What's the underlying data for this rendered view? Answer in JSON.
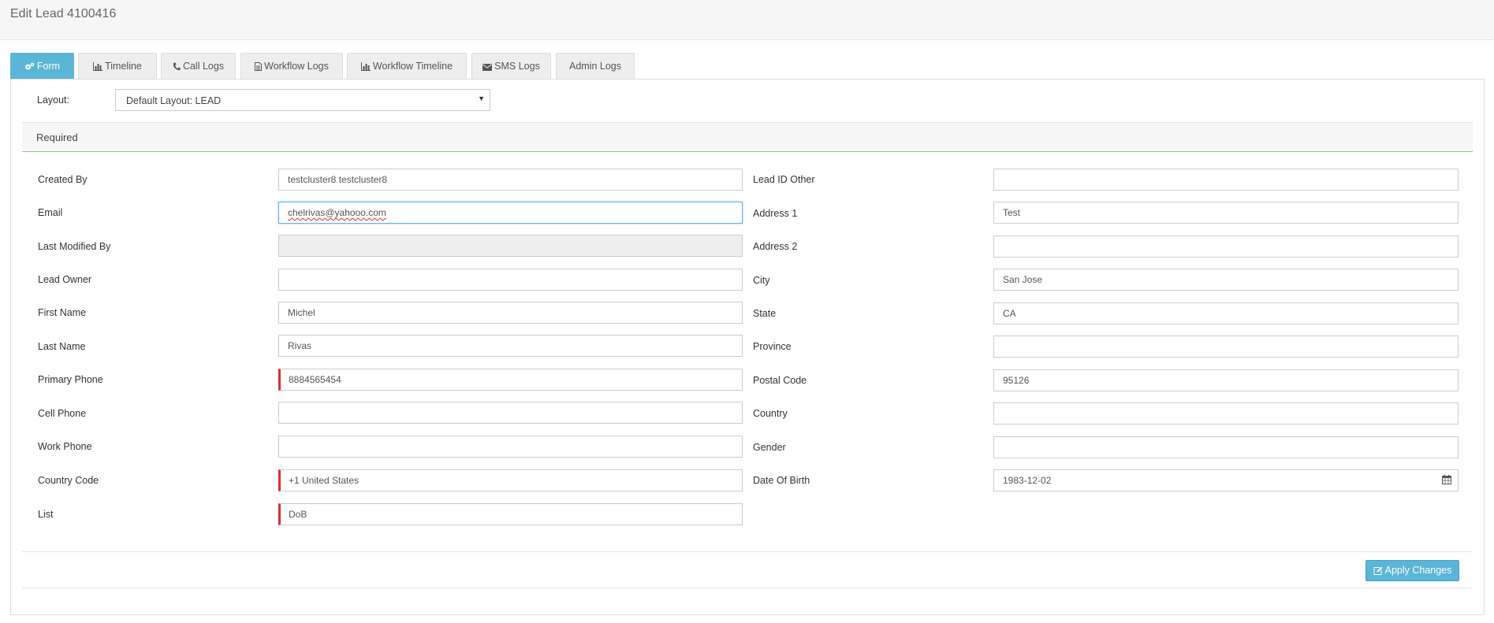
{
  "header": {
    "title": "Edit Lead 4100416"
  },
  "tabs": [
    {
      "label": "Form",
      "icon": "cogs-icon",
      "active": true
    },
    {
      "label": "Timeline",
      "icon": "bar-chart-icon"
    },
    {
      "label": "Call Logs",
      "icon": "phone-icon"
    },
    {
      "label": "Workflow Logs",
      "icon": "file-icon"
    },
    {
      "label": "Workflow Timeline",
      "icon": "bar-chart-icon"
    },
    {
      "label": "SMS Logs",
      "icon": "envelope-icon"
    },
    {
      "label": "Admin Logs",
      "icon": ""
    }
  ],
  "layout": {
    "label": "Layout:",
    "selected": "Default Layout: LEAD"
  },
  "section": {
    "title": "Required"
  },
  "left_fields": [
    {
      "label": "Created By",
      "value": "testcluster8 testcluster8"
    },
    {
      "label": "Email",
      "value": "chelrivas@yahooo.com",
      "focused": true
    },
    {
      "label": "Last Modified By",
      "value": "",
      "disabled": true
    },
    {
      "label": "Lead Owner",
      "value": ""
    },
    {
      "label": "First Name",
      "value": "Michel"
    },
    {
      "label": "Last Name",
      "value": "Rivas"
    },
    {
      "label": "Primary Phone",
      "value": "8884565454",
      "required": true
    },
    {
      "label": "Cell Phone",
      "value": ""
    },
    {
      "label": "Work Phone",
      "value": ""
    },
    {
      "label": "Country Code",
      "value": "+1 United States",
      "required": true
    },
    {
      "label": "List",
      "value": "DoB",
      "required": true
    }
  ],
  "right_fields": [
    {
      "label": "Lead ID Other",
      "value": ""
    },
    {
      "label": "Address 1",
      "value": "Test"
    },
    {
      "label": "Address 2",
      "value": ""
    },
    {
      "label": "City",
      "value": "San Jose"
    },
    {
      "label": "State",
      "value": "CA"
    },
    {
      "label": "Province",
      "value": ""
    },
    {
      "label": "Postal Code",
      "value": "95126"
    },
    {
      "label": "Country",
      "value": ""
    },
    {
      "label": "Gender",
      "value": ""
    },
    {
      "label": "Date Of Birth",
      "value": "1983-12-02",
      "icon": "calendar-icon"
    }
  ],
  "actions": {
    "apply_label": "Apply Changes",
    "apply_icon": "edit-icon"
  },
  "colors": {
    "accent": "#5bb5d6",
    "required": "#d9302f",
    "section_border": "#8fca8a"
  }
}
